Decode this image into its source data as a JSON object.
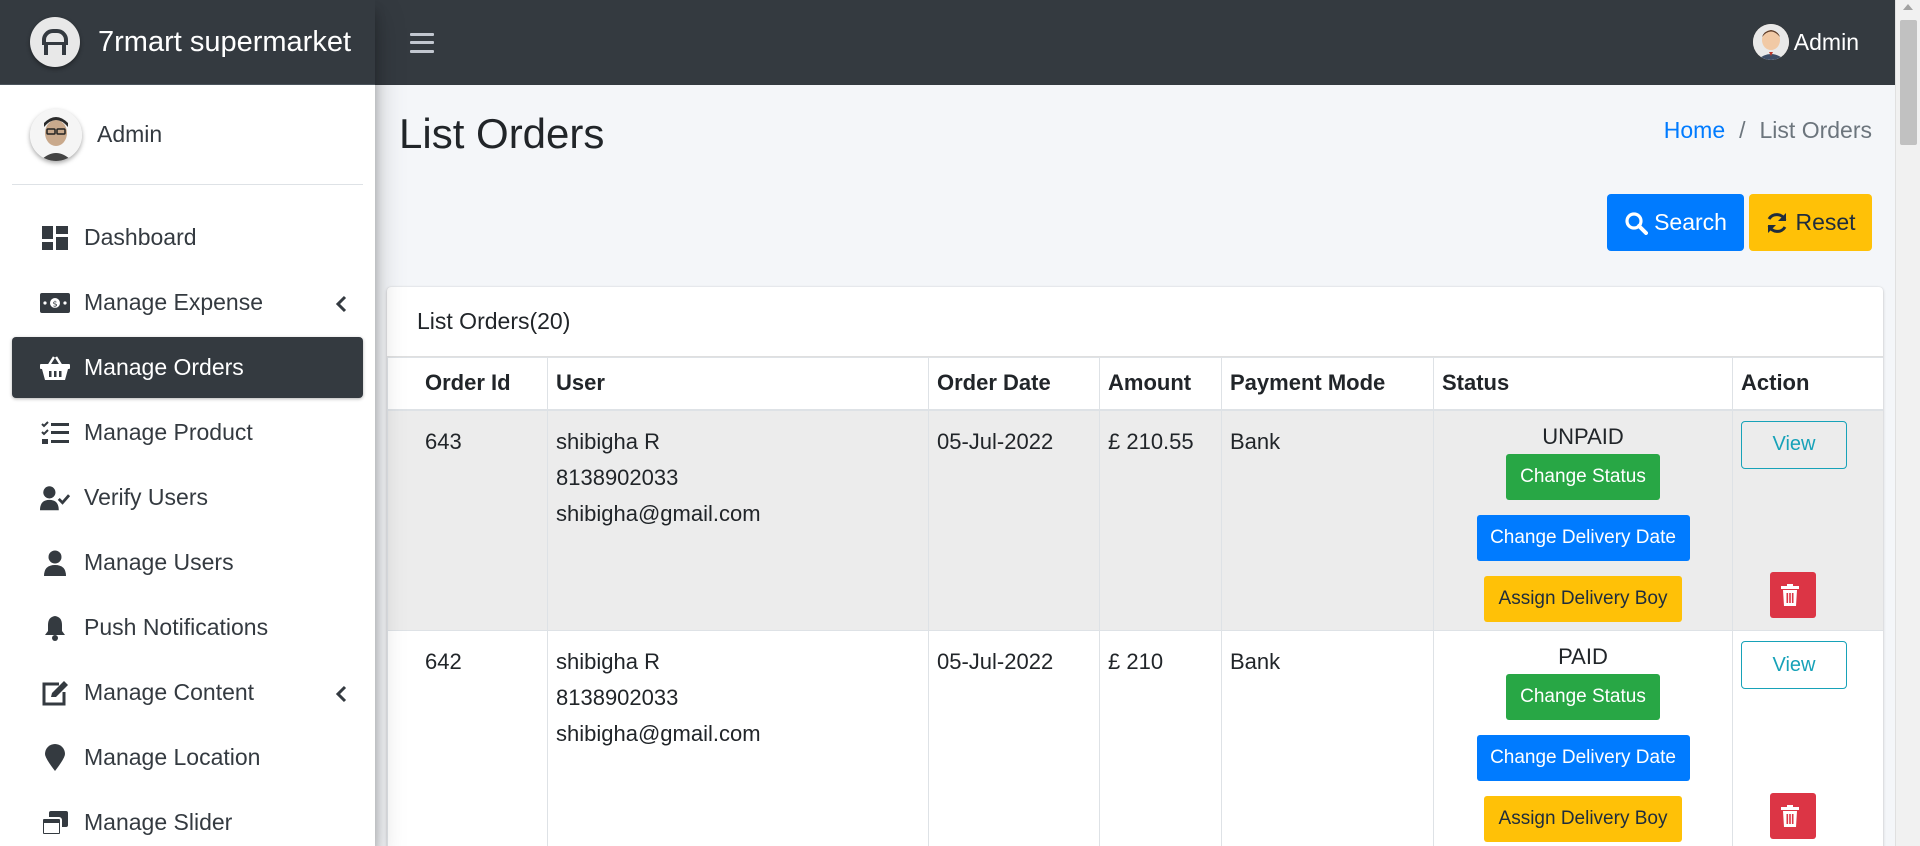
{
  "brand": {
    "name": "7rmart supermarket"
  },
  "sidebar": {
    "user_name": "Admin",
    "items": [
      {
        "label": "Dashboard",
        "icon": "dashboard-icon"
      },
      {
        "label": "Manage Expense",
        "icon": "money-icon",
        "has_caret": true
      },
      {
        "label": "Manage Orders",
        "icon": "basket-icon",
        "active": true
      },
      {
        "label": "Manage Product",
        "icon": "tasks-icon"
      },
      {
        "label": "Verify Users",
        "icon": "user-check-icon"
      },
      {
        "label": "Manage Users",
        "icon": "user-icon"
      },
      {
        "label": "Push Notifications",
        "icon": "bell-icon"
      },
      {
        "label": "Manage Content",
        "icon": "edit-icon",
        "has_caret": true
      },
      {
        "label": "Manage Location",
        "icon": "map-marker-icon"
      },
      {
        "label": "Manage Slider",
        "icon": "window-restore-icon"
      }
    ]
  },
  "topbar": {
    "user_name": "Admin"
  },
  "page": {
    "title": "List Orders",
    "breadcrumb": {
      "home": "Home",
      "separator": "/",
      "current": "List Orders"
    },
    "search_label": "Search",
    "reset_label": "Reset"
  },
  "card": {
    "title": "List Orders(20)",
    "columns": [
      "Order Id",
      "User",
      "Order Date",
      "Amount",
      "Payment Mode",
      "Status",
      "Action"
    ],
    "rows": [
      {
        "order_id": "643",
        "user_name": "shibigha R",
        "user_phone": "8138902033",
        "user_email": "shibigha@gmail.com",
        "order_date": "05-Jul-2022",
        "amount": "£ 210.55",
        "payment_mode": "Bank",
        "status": "UNPAID"
      },
      {
        "order_id": "642",
        "user_name": "shibigha R",
        "user_phone": "8138902033",
        "user_email": "shibigha@gmail.com",
        "order_date": "05-Jul-2022",
        "amount": "£ 210",
        "payment_mode": "Bank",
        "status": "PAID"
      }
    ],
    "actions": {
      "change_status": "Change Status",
      "change_delivery_date": "Change Delivery Date",
      "assign_delivery_boy": "Assign Delivery Boy",
      "view": "View"
    }
  },
  "colors": {
    "primary": "#007bff",
    "warning": "#ffc107",
    "success": "#28a745",
    "danger": "#dc3545",
    "info": "#17a2b8",
    "dark": "#343a40"
  }
}
